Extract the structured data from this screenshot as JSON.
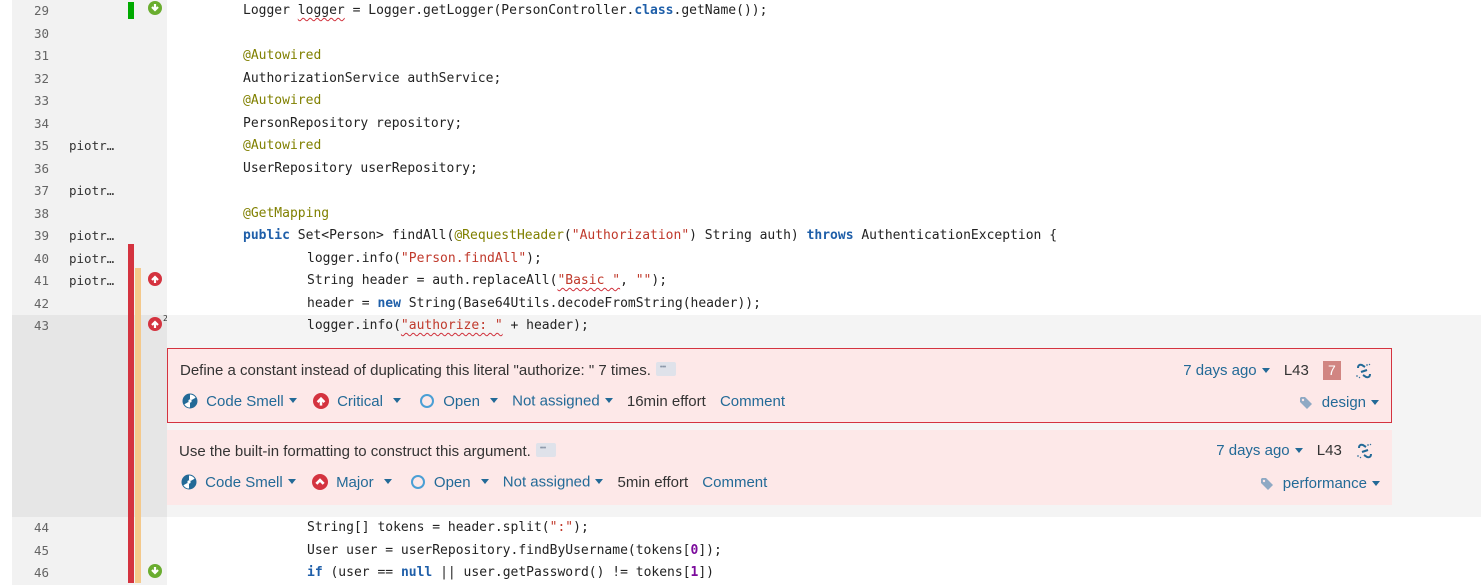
{
  "code_lines": [
    {
      "num": "29",
      "author": "",
      "text": "Logger logger = Logger.getLogger(PersonController.class.getName());"
    },
    {
      "num": "30",
      "author": "",
      "text": ""
    },
    {
      "num": "31",
      "author": "",
      "text": "@Autowired"
    },
    {
      "num": "32",
      "author": "",
      "text": "AuthorizationService authService;"
    },
    {
      "num": "33",
      "author": "",
      "text": "@Autowired"
    },
    {
      "num": "34",
      "author": "",
      "text": "PersonRepository repository;"
    },
    {
      "num": "35",
      "author": "piotr…",
      "text": "@Autowired"
    },
    {
      "num": "36",
      "author": "",
      "text": "UserRepository userRepository;"
    },
    {
      "num": "37",
      "author": "piotr…",
      "text": ""
    },
    {
      "num": "38",
      "author": "",
      "text": "@GetMapping"
    },
    {
      "num": "39",
      "author": "piotr…",
      "text": "public Set<Person> findAll(@RequestHeader(\"Authorization\") String auth) throws AuthenticationException {"
    },
    {
      "num": "40",
      "author": "piotr…",
      "text": "logger.info(\"Person.findAll\");"
    },
    {
      "num": "41",
      "author": "piotr…",
      "text": "String header = auth.replaceAll(\"Basic \", \"\");"
    },
    {
      "num": "42",
      "author": "",
      "text": "header = new String(Base64Utils.decodeFromString(header));"
    },
    {
      "num": "43",
      "author": "",
      "text": "logger.info(\"authorize: \" + header);",
      "issue_count": "2"
    },
    {
      "num": "44",
      "author": "",
      "text": "String[] tokens = header.split(\":\");"
    },
    {
      "num": "45",
      "author": "",
      "text": "User user = userRepository.findByUsername(tokens[0]);"
    },
    {
      "num": "46",
      "author": "",
      "text": "if (user == null || user.getPassword() != tokens[1])"
    }
  ],
  "issues": [
    {
      "message": "Define a constant instead of duplicating this literal \"authorize: \" 7 times.",
      "type": "Code Smell",
      "severity": "Critical",
      "status": "Open",
      "assignee": "Not assigned",
      "effort": "16min effort",
      "comment_label": "Comment",
      "age": "7 days ago",
      "line": "L43",
      "locations_count": "7",
      "tag": "design",
      "selected": true
    },
    {
      "message": "Use the built-in formatting to construct this argument.",
      "type": "Code Smell",
      "severity": "Major",
      "status": "Open",
      "assignee": "Not assigned",
      "effort": "5min effort",
      "comment_label": "Comment",
      "age": "7 days ago",
      "line": "L43",
      "tag": "performance",
      "selected": false
    }
  ],
  "colors": {
    "new_code_bar": "#00aa00",
    "duplication_bar": "#d4333f",
    "coverage_bar": "#f4c98b",
    "issue_bg": "#fde8e8",
    "link": "#236a97",
    "critical": "#d4333f"
  }
}
